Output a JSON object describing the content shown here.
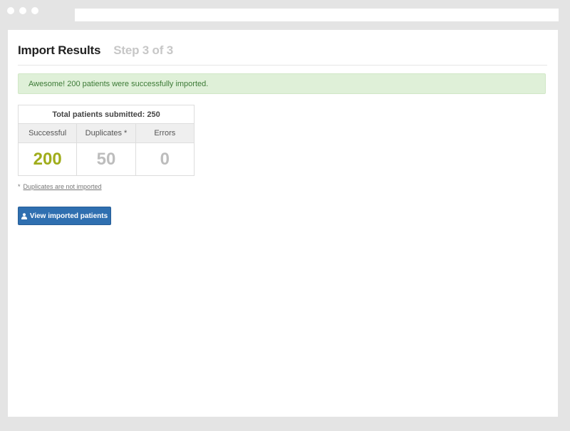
{
  "header": {
    "title": "Import Results",
    "step": "Step 3 of 3"
  },
  "alert": {
    "message": "Awesome! 200 patients were successfully imported.",
    "color": "#dff0d8"
  },
  "stats": {
    "total_label": "Total patients submitted: 250",
    "columns": [
      "Successful",
      "Duplicates *",
      "Errors"
    ],
    "values": [
      "200",
      "50",
      "0"
    ],
    "colors": {
      "successful": "#a0ad1c",
      "other": "#bdbdbd"
    }
  },
  "footnote": {
    "star": "*",
    "text": "Duplicates are not imported"
  },
  "actions": {
    "view_button_label": "View imported patients",
    "view_button_icon": "user-icon",
    "button_color": "#2f6fb0"
  }
}
